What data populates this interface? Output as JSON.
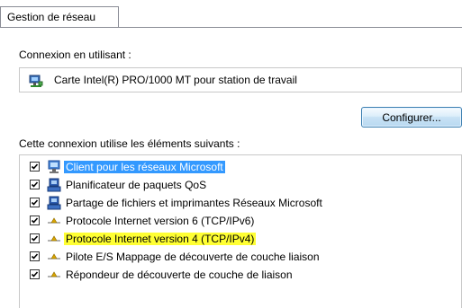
{
  "tab": {
    "label": "Gestion de réseau"
  },
  "connect_label": "Connexion en utilisant :",
  "adapter": {
    "name": "Carte Intel(R) PRO/1000 MT pour station de travail",
    "icon": "network-adapter-icon"
  },
  "configure_button": "Configurer...",
  "items_label": "Cette connexion utilise les éléments suivants :",
  "items": [
    {
      "label": "Client pour les réseaux Microsoft",
      "checked": true,
      "icon": "network-client-icon",
      "state": "selected"
    },
    {
      "label": "Planificateur de paquets QoS",
      "checked": true,
      "icon": "network-service-icon",
      "state": "normal"
    },
    {
      "label": "Partage de fichiers et imprimantes Réseaux Microsoft",
      "checked": true,
      "icon": "network-service-icon",
      "state": "normal"
    },
    {
      "label": "Protocole Internet version 6 (TCP/IPv6)",
      "checked": true,
      "icon": "protocol-icon",
      "state": "normal"
    },
    {
      "label": "Protocole Internet version 4 (TCP/IPv4)",
      "checked": true,
      "icon": "protocol-icon",
      "state": "highlighted"
    },
    {
      "label": "Pilote E/S Mappage de découverte de couche liaison",
      "checked": true,
      "icon": "protocol-icon",
      "state": "normal"
    },
    {
      "label": "Répondeur de découverte de couche de liaison",
      "checked": true,
      "icon": "protocol-icon",
      "state": "normal"
    }
  ],
  "colors": {
    "selection": "#3399ff",
    "highlight": "#ffff33",
    "border": "#898c95"
  }
}
